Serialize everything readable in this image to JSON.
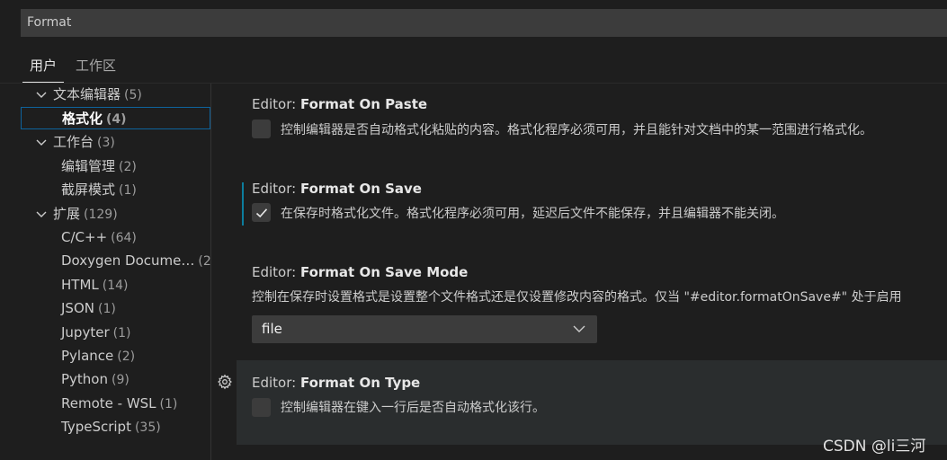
{
  "search": {
    "value": "Format"
  },
  "tabs": [
    {
      "label": "用户"
    },
    {
      "label": "工作区"
    }
  ],
  "toc": [
    {
      "label": "文本编辑器",
      "count": "(5)"
    },
    {
      "label": "格式化",
      "count": "(4)"
    },
    {
      "label": "工作台",
      "count": "(3)"
    },
    {
      "label": "编辑管理",
      "count": "(2)"
    },
    {
      "label": "截屏模式",
      "count": "(1)"
    },
    {
      "label": "扩展",
      "count": "(129)"
    },
    {
      "label": "C/C++",
      "count": "(64)"
    },
    {
      "label": "Doxygen Docume…",
      "count": "(2)"
    },
    {
      "label": "HTML",
      "count": "(14)"
    },
    {
      "label": "JSON",
      "count": "(1)"
    },
    {
      "label": "Jupyter",
      "count": "(1)"
    },
    {
      "label": "Pylance",
      "count": "(2)"
    },
    {
      "label": "Python",
      "count": "(9)"
    },
    {
      "label": "Remote - WSL",
      "count": "(1)"
    },
    {
      "label": "TypeScript",
      "count": "(35)"
    }
  ],
  "settings": {
    "paste": {
      "category": "Editor: ",
      "name": "Format On Paste",
      "description": "控制编辑器是否自动格式化粘贴的内容。格式化程序必须可用，并且能针对文档中的某一范围进行格式化。",
      "checked": false
    },
    "save": {
      "category": "Editor: ",
      "name": "Format On Save",
      "description": "在保存时格式化文件。格式化程序必须可用，延迟后文件不能保存，并且编辑器不能关闭。",
      "checked": true
    },
    "save_mode": {
      "category": "Editor: ",
      "name": "Format On Save Mode",
      "description": "控制在保存时设置格式是设置整个文件格式还是仅设置修改内容的格式。仅当 \"#editor.formatOnSave#\" 处于启用",
      "value": "file"
    },
    "type": {
      "category": "Editor: ",
      "name": "Format On Type",
      "description": "控制编辑器在键入一行后是否自动格式化该行。",
      "checked": false
    }
  },
  "watermark": "CSDN @li三河",
  "colors": {
    "background": "#1e1e1e",
    "input": "#3c3c3c",
    "focus_border": "#0e639c",
    "modified_indicator": "#0c7d9d",
    "hover_row": "#2a2d2e"
  }
}
